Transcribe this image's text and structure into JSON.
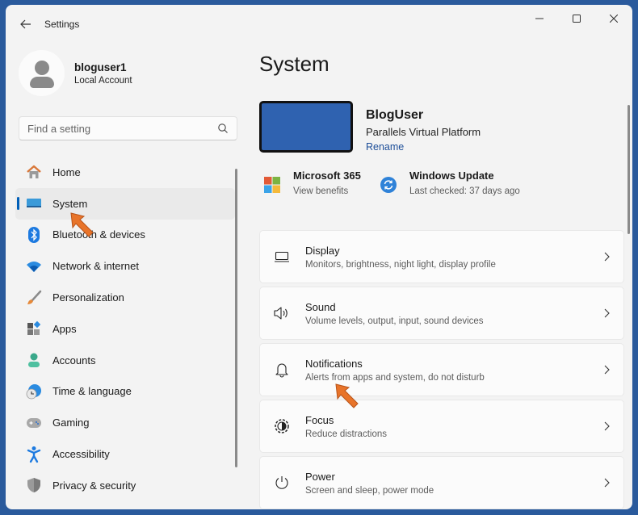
{
  "window": {
    "app_title": "Settings",
    "controls": {
      "minimize": "—",
      "maximize": "☐",
      "close": "✕"
    }
  },
  "profile": {
    "username": "bloguser1",
    "account_type": "Local Account"
  },
  "search": {
    "placeholder": "Find a setting"
  },
  "sidebar": {
    "items": [
      {
        "label": "Home",
        "icon": "home-icon",
        "active": false
      },
      {
        "label": "System",
        "icon": "system-icon",
        "active": true
      },
      {
        "label": "Bluetooth & devices",
        "icon": "bluetooth-icon",
        "active": false
      },
      {
        "label": "Network & internet",
        "icon": "wifi-icon",
        "active": false
      },
      {
        "label": "Personalization",
        "icon": "brush-icon",
        "active": false
      },
      {
        "label": "Apps",
        "icon": "apps-icon",
        "active": false
      },
      {
        "label": "Accounts",
        "icon": "accounts-icon",
        "active": false
      },
      {
        "label": "Time & language",
        "icon": "time-language-icon",
        "active": false
      },
      {
        "label": "Gaming",
        "icon": "gamepad-icon",
        "active": false
      },
      {
        "label": "Accessibility",
        "icon": "accessibility-icon",
        "active": false
      },
      {
        "label": "Privacy & security",
        "icon": "shield-icon",
        "active": false
      }
    ]
  },
  "main": {
    "title": "System",
    "device": {
      "name": "BlogUser",
      "model": "Parallels Virtual Platform",
      "rename_label": "Rename"
    },
    "quick_links": [
      {
        "title": "Microsoft 365",
        "subtitle": "View benefits",
        "icon": "microsoft-logo-icon"
      },
      {
        "title": "Windows Update",
        "subtitle": "Last checked: 37 days ago",
        "icon": "windows-update-icon"
      }
    ],
    "cards": [
      {
        "title": "Display",
        "subtitle": "Monitors, brightness, night light, display profile",
        "icon": "display-icon"
      },
      {
        "title": "Sound",
        "subtitle": "Volume levels, output, input, sound devices",
        "icon": "speaker-icon"
      },
      {
        "title": "Notifications",
        "subtitle": "Alerts from apps and system, do not disturb",
        "icon": "bell-icon"
      },
      {
        "title": "Focus",
        "subtitle": "Reduce distractions",
        "icon": "focus-icon"
      },
      {
        "title": "Power",
        "subtitle": "Screen and sleep, power mode",
        "icon": "power-icon"
      }
    ]
  },
  "colors": {
    "accent": "#005fb8",
    "pointer": "#e8742a",
    "frame": "#2a5a9c"
  }
}
